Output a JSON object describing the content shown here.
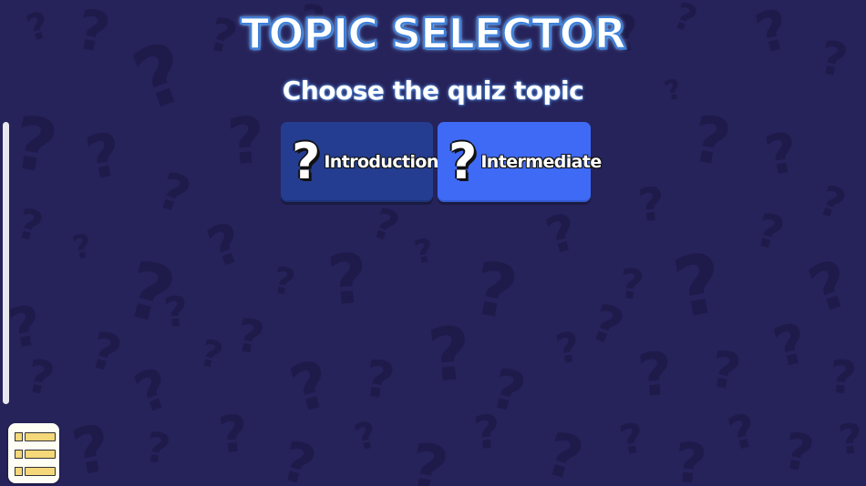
{
  "header": {
    "title": "TOPIC SELECTOR",
    "subtitle": "Choose the quiz topic"
  },
  "topics": [
    {
      "label": "Introduction",
      "icon": "question-mark-icon",
      "selected": false,
      "color": "#243d90"
    },
    {
      "label": "Intermediate",
      "icon": "question-mark-icon",
      "selected": true,
      "color": "#3f6af5"
    }
  ],
  "menu": {
    "icon": "list-menu-icon"
  },
  "theme": {
    "background": "#26225a",
    "pattern_color": "#1e1a4a",
    "title_outline": "#3d7fd9"
  }
}
